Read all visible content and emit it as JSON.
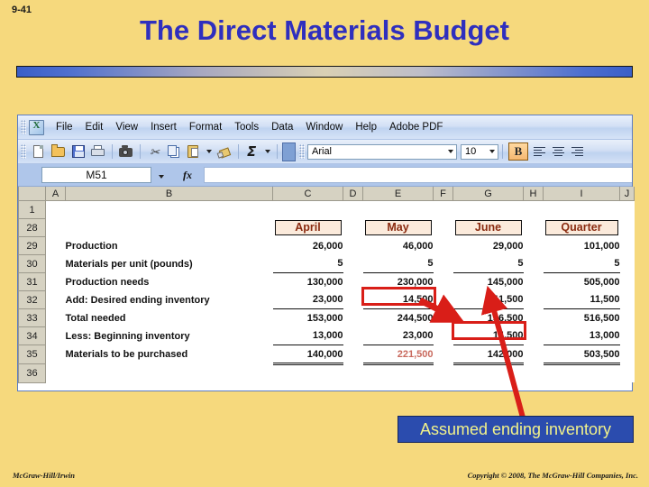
{
  "slide": {
    "number": "9-41",
    "title": "The Direct Materials Budget"
  },
  "excel": {
    "menus": [
      "File",
      "Edit",
      "View",
      "Insert",
      "Format",
      "Tools",
      "Data",
      "Window",
      "Help",
      "Adobe PDF"
    ],
    "toolbar": {
      "icons": [
        "new-document",
        "open-folder",
        "save-disk",
        "print",
        "camera",
        "cut-scissors",
        "copy",
        "paste",
        "format-painter",
        "autosum-sigma"
      ],
      "font_name": "Arial",
      "font_size": "10",
      "bold_label": "B"
    },
    "name_box": "M51",
    "fx_label": "fx",
    "column_headers": [
      "A",
      "B",
      "C",
      "D",
      "E",
      "F",
      "G",
      "H",
      "I",
      "J"
    ],
    "row_numbers": [
      "1",
      "28",
      "29",
      "30",
      "31",
      "32",
      "33",
      "34",
      "35",
      "36"
    ],
    "table": {
      "period_headers": [
        "April",
        "May",
        "June",
        "Quarter"
      ],
      "rows": [
        {
          "label": "Production",
          "values": [
            "26,000",
            "46,000",
            "29,000",
            "101,000"
          ]
        },
        {
          "label": "Materials per unit (pounds)",
          "values": [
            "5",
            "5",
            "5",
            "5"
          ]
        },
        {
          "label": "Production needs",
          "values": [
            "130,000",
            "230,000",
            "145,000",
            "505,000"
          ]
        },
        {
          "label": "Add: Desired ending inventory",
          "values": [
            "23,000",
            "14,500",
            "11,500",
            "11,500"
          ]
        },
        {
          "label": "Total needed",
          "values": [
            "153,000",
            "244,500",
            "156,500",
            "516,500"
          ]
        },
        {
          "label": "Less: Beginning inventory",
          "values": [
            "13,000",
            "23,000",
            "14,500",
            "13,000"
          ]
        },
        {
          "label": "Materials to be purchased",
          "values": [
            "140,000",
            "221,500",
            "142,000",
            "503,500"
          ]
        }
      ]
    }
  },
  "callout": {
    "text": "Assumed ending inventory"
  },
  "footer": {
    "left": "McGraw-Hill/Irwin",
    "right": "Copyright © 2008, The McGraw-Hill Companies, Inc."
  },
  "colors": {
    "slide_bg": "#F6D97D",
    "title_blue": "#2F2FBE",
    "highlight_red": "#D91E18",
    "callout_bg": "#2B4CAE",
    "callout_text": "#F2F28A",
    "month_header_text": "#8A2B10"
  }
}
